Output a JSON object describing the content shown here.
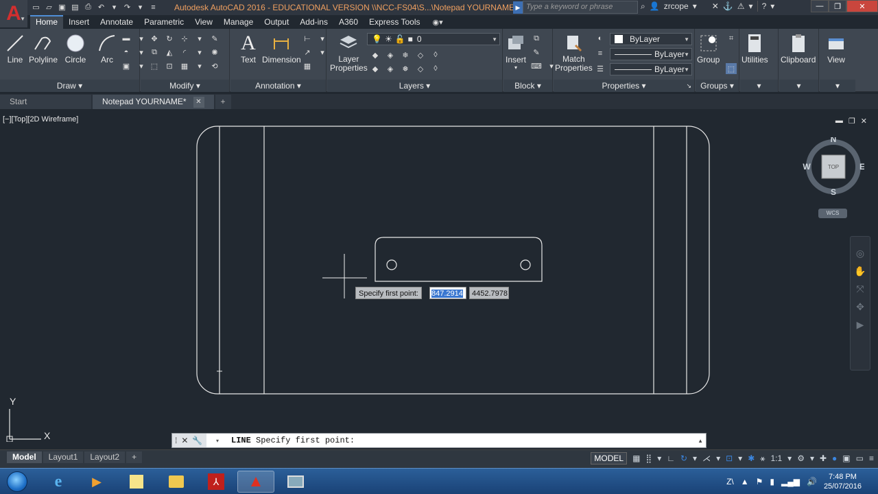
{
  "titlebar": {
    "title": "Autodesk AutoCAD 2016 - EDUCATIONAL VERSION     \\\\NCC-FS04\\S...\\Notepad YOURNAME.dwg",
    "search_placeholder": "Type a keyword or phrase",
    "user": "zrcope",
    "app_logo": "A"
  },
  "ribbon_tabs": [
    "Home",
    "Insert",
    "Annotate",
    "Parametric",
    "View",
    "Manage",
    "Output",
    "Add-ins",
    "A360",
    "Express Tools"
  ],
  "ribbon": {
    "draw": {
      "title": "Draw",
      "line": "Line",
      "polyline": "Polyline",
      "circle": "Circle",
      "arc": "Arc"
    },
    "modify": {
      "title": "Modify"
    },
    "annotation": {
      "title": "Annotation",
      "text": "Text",
      "dimension": "Dimension"
    },
    "layers": {
      "title": "Layers",
      "layer_properties": "Layer\nProperties",
      "current_layer": "0"
    },
    "block": {
      "title": "Block",
      "insert": "Insert"
    },
    "properties": {
      "title": "Properties",
      "match": "Match\nProperties",
      "color": "ByLayer",
      "linetype": "ByLayer",
      "lineweight": "ByLayer"
    },
    "groups": {
      "title": "Groups",
      "group": "Group"
    },
    "utilities": "Utilities",
    "clipboard": "Clipboard",
    "view": "View"
  },
  "file_tabs": {
    "start": "Start",
    "current": "Notepad YOURNAME*"
  },
  "viewport": {
    "label": "[−][Top][2D Wireframe]",
    "viewcube": {
      "top": "TOP",
      "n": "N",
      "s": "S",
      "e": "E",
      "w": "W"
    },
    "wcs": "WCS",
    "prompt": "Specify first point:",
    "coord_x": "847.2914",
    "coord_y": "4452.7978",
    "ucs_x": "X",
    "ucs_y": "Y"
  },
  "command_line": {
    "command": "LINE",
    "text": "Specify first point:"
  },
  "layout_tabs": [
    "Model",
    "Layout1",
    "Layout2"
  ],
  "status": {
    "model": "MODEL",
    "scale": "1:1"
  },
  "taskbar": {
    "time": "7:48 PM",
    "date": "25/07/2016",
    "lang": "Z\\"
  },
  "colors": {
    "canvas": "#212830",
    "ribbon": "#3f4751",
    "accent": "#4f8ed8",
    "title_text": "#f0a060"
  }
}
